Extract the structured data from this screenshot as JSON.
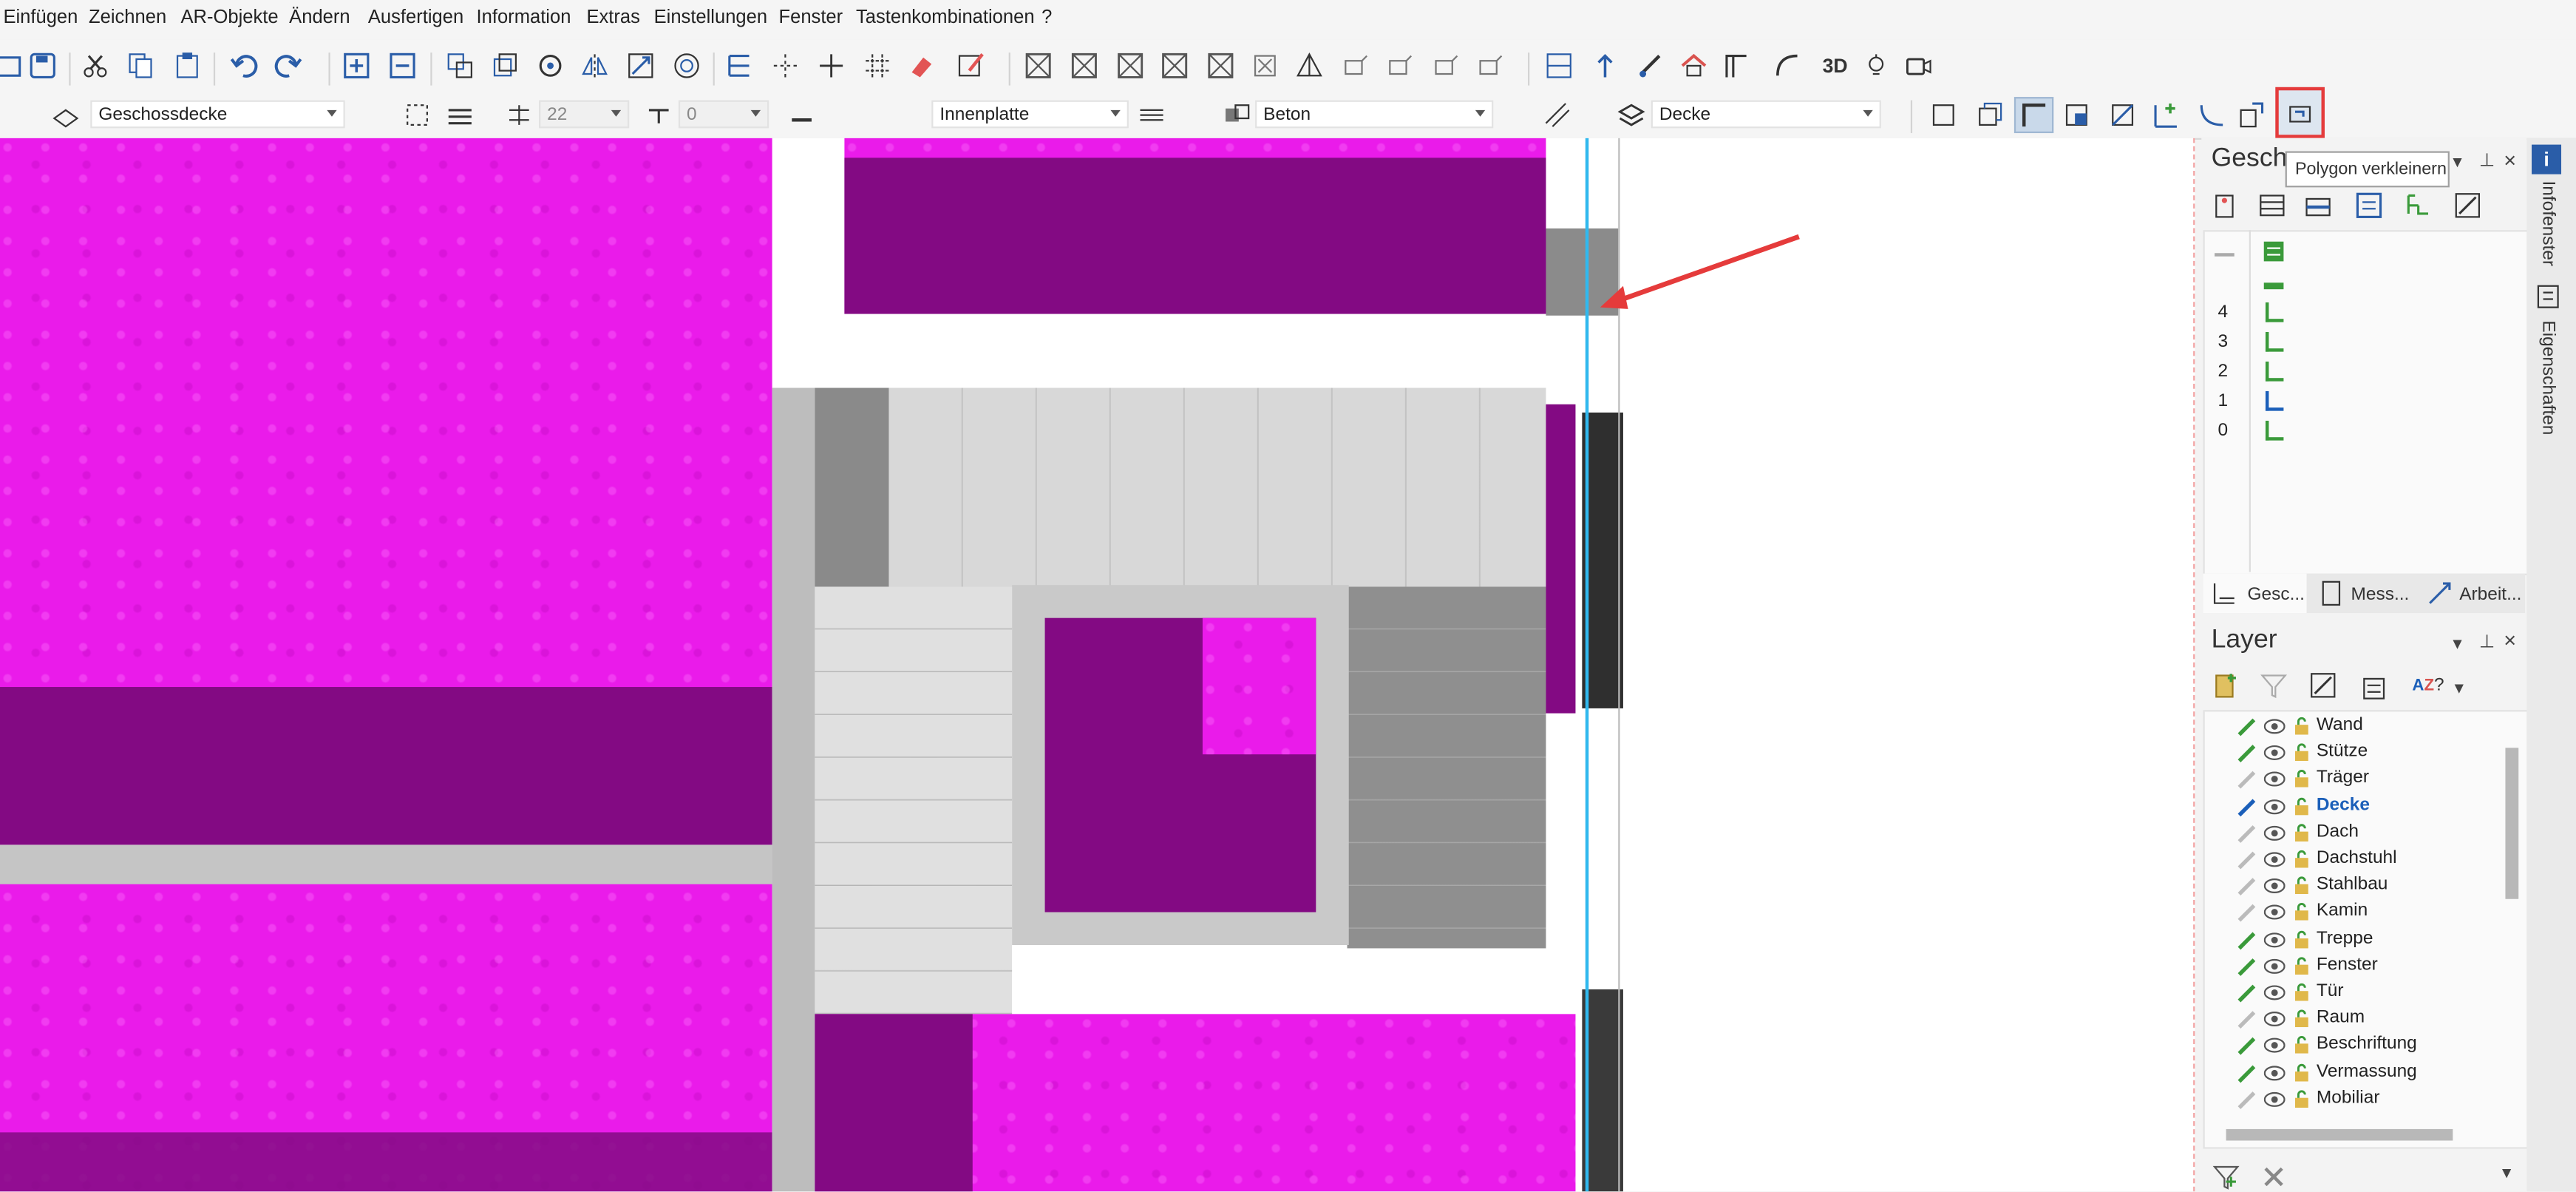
{
  "menu": [
    "Einfügen",
    "Zeichnen",
    "AR-Objekte",
    "Ändern",
    "Ausfertigen",
    "Information",
    "Extras",
    "Einstellungen",
    "Fenster",
    "Tastenkombinationen",
    "?"
  ],
  "toolbar2": {
    "object_type": "Geschossdecke",
    "thickness": "22",
    "offset": "0",
    "layer_type": "Innenplatte",
    "material": "Beton",
    "layer": "Decke"
  },
  "tooltip": "Polygon verkleinern",
  "geschoss_panel": {
    "title": "Gesch",
    "floors": [
      "4",
      "3",
      "2",
      "1",
      "0"
    ],
    "tabs": [
      "Gesc...",
      "Mess...",
      "Arbeit..."
    ]
  },
  "layer_panel": {
    "title": "Layer",
    "layers": [
      {
        "name": "Wand",
        "active": false
      },
      {
        "name": "Stütze",
        "active": false
      },
      {
        "name": "Träger",
        "active": false
      },
      {
        "name": "Decke",
        "active": true
      },
      {
        "name": "Dach",
        "active": false
      },
      {
        "name": "Dachstuhl",
        "active": false
      },
      {
        "name": "Stahlbau",
        "active": false
      },
      {
        "name": "Kamin",
        "active": false
      },
      {
        "name": "Treppe",
        "active": false
      },
      {
        "name": "Fenster",
        "active": false
      },
      {
        "name": "Tür",
        "active": false
      },
      {
        "name": "Raum",
        "active": false
      },
      {
        "name": "Beschriftung",
        "active": false
      },
      {
        "name": "Vermassung",
        "active": false
      },
      {
        "name": "Mobiliar",
        "active": false
      }
    ]
  },
  "side_tabs": [
    "Infofenster",
    "Eigenschaften"
  ],
  "toolbar1_icons": [
    "save-icon",
    "cut-icon",
    "copy-icon",
    "paste-icon",
    "undo-icon",
    "redo-icon",
    "add-icon",
    "subtract-icon",
    "rectangle-icon",
    "grid-icon",
    "eraser-icon",
    "pencil-icon",
    "cross-box-icon",
    "pyramid-icon",
    "house-icon",
    "stairs-icon",
    "arc-icon",
    "3d-icon",
    "lamp-icon",
    "camera-icon"
  ],
  "text_3d": "3D",
  "colors": {
    "magenta": "#ea1bea",
    "purple": "#830a83",
    "highlight": "#e53b3b",
    "accent_blue": "#1b5fb9"
  }
}
